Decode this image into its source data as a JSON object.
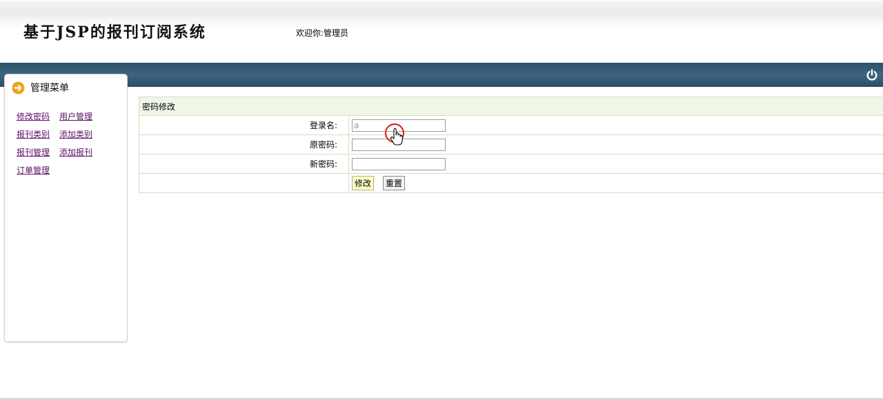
{
  "header": {
    "site_title": "基于JSP的报刊订阅系统",
    "welcome": "欢迎你:管理员"
  },
  "topbar": {
    "power_icon": "power-icon"
  },
  "sidebar": {
    "title": "管理菜单",
    "title_icon": "arrow-right-circle-icon",
    "menu": [
      [
        "修改密码",
        "用户管理"
      ],
      [
        "报刊类别",
        "添加类别"
      ],
      [
        "报刊管理",
        "添加报刊"
      ],
      [
        "订单管理"
      ]
    ]
  },
  "form": {
    "caption": "密码修改",
    "username_label": "登录名:",
    "username_value": "a",
    "old_password_label": "原密码:",
    "new_password_label": "新密码:",
    "submit_label": "修改",
    "reset_label": "重置"
  },
  "colors": {
    "topbar": "#35596f",
    "accent_orange": "#f0a21a",
    "menu_link": "#5a0f63",
    "table_border": "#d7dcb9",
    "caption_bg": "#eef6e8"
  }
}
